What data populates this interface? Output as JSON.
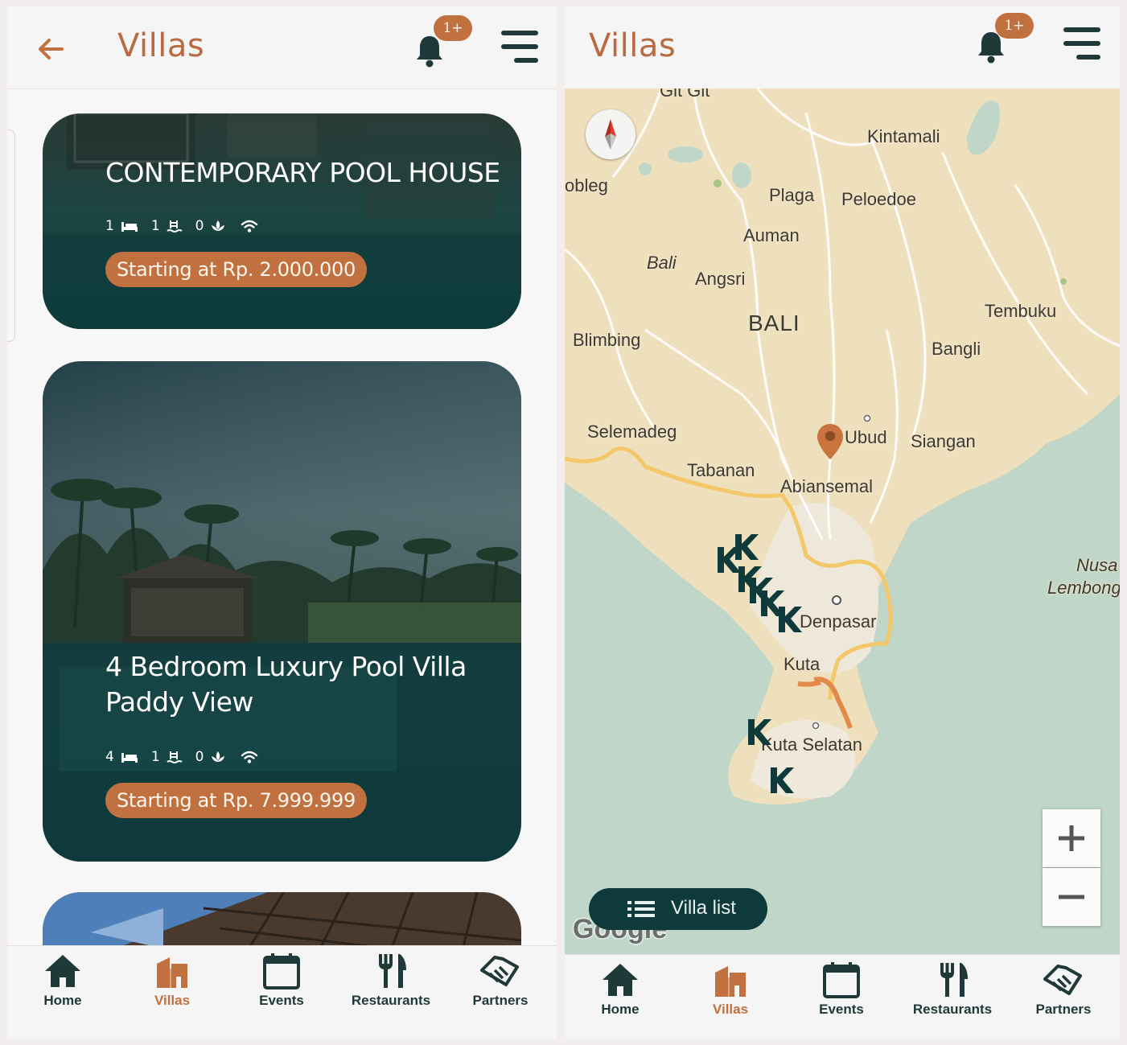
{
  "left_screen": {
    "header": {
      "title": "Villas",
      "notification_badge": "1+"
    },
    "cards": [
      {
        "name": "CONTEMPORARY POOL HOUSE",
        "bedrooms": "1",
        "bathrooms": "1",
        "pools": "0",
        "price": "Starting at Rp. 2.000.000"
      },
      {
        "name_line1": "4 Bedroom Luxury Pool Villa",
        "name_line2": "Paddy View",
        "bedrooms": "4",
        "bathrooms": "1",
        "pools": "0",
        "price": "Starting at Rp. 7.999.999"
      }
    ],
    "nav": [
      {
        "label": "Home",
        "icon": "home-icon"
      },
      {
        "label": "Villas",
        "icon": "villas-icon",
        "active": true
      },
      {
        "label": "Events",
        "icon": "calendar-icon"
      },
      {
        "label": "Restaurants",
        "icon": "fork-knife-icon"
      },
      {
        "label": "Partners",
        "icon": "handshake-icon"
      }
    ]
  },
  "right_screen": {
    "header": {
      "title": "Villas",
      "notification_badge": "1+"
    },
    "map": {
      "labels": {
        "gitgit": "Git Git",
        "kintamani": "Kintamali",
        "gobleg": "obleg",
        "plaga": "Plaga",
        "peloedoe": "Peloedoe",
        "auman": "Auman",
        "bali_it": "Bali",
        "angsri": "Angsri",
        "bali": "BALI",
        "tembuku": "Tembuku",
        "blimbing": "Blimbing",
        "bangli": "Bangli",
        "selemadeg": "Selemadeg",
        "ubud": "Ubud",
        "siangan": "Siangan",
        "tabanan": "Tabanan",
        "abiansemal": "Abiansemal",
        "nusa": "Nusa",
        "lembong": "Lembong",
        "denpasar": "Denpasar",
        "kuta": "Kuta",
        "kuta_selatan": "Kuta Selatan"
      },
      "attribution": "Google",
      "villa_list_button": "Villa list",
      "zoom_in": "+",
      "zoom_out": "−"
    },
    "nav": [
      {
        "label": "Home",
        "icon": "home-icon"
      },
      {
        "label": "Villas",
        "icon": "villas-icon",
        "active": true
      },
      {
        "label": "Events",
        "icon": "calendar-icon"
      },
      {
        "label": "Restaurants",
        "icon": "fork-knife-icon"
      },
      {
        "label": "Partners",
        "icon": "handshake-icon"
      }
    ]
  },
  "colors": {
    "accent": "#c17140",
    "dark_teal": "#0f3a3c",
    "nav_dark": "#1f3838",
    "map_land": "#efe0bd",
    "map_water": "#bfd6c8"
  }
}
